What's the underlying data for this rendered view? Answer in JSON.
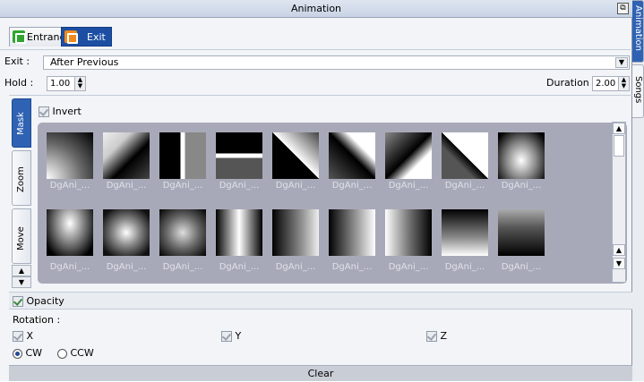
{
  "window": {
    "title": "Animation"
  },
  "tabs": {
    "entrance": "Entrance",
    "exit": "Exit"
  },
  "exit_row": {
    "label": "Exit :",
    "value": "After Previous"
  },
  "hold": {
    "label": "Hold :",
    "value": "1.00"
  },
  "duration": {
    "label": "Duration :",
    "value": "2.00"
  },
  "side_tabs": [
    "Mask",
    "Zoom",
    "Move"
  ],
  "invert": {
    "label": "Invert",
    "checked": true
  },
  "gallery": {
    "row1": [
      "DgAni_...",
      "DgAni_...",
      "DgAni_...",
      "DgAni_...",
      "DgAni_...",
      "DgAni_...",
      "DgAni_...",
      "DgAni_...",
      "DgAni_..."
    ],
    "row2": [
      "DgAni_...",
      "DgAni_...",
      "DgAni_...",
      "DgAni_...",
      "DgAni_...",
      "DgAni_...",
      "DgAni_...",
      "DgAni_...",
      "DgAni_..."
    ]
  },
  "opacity": {
    "label": "Opacity",
    "checked": true
  },
  "rotation": {
    "label": "Rotation :",
    "x": "X",
    "y": "Y",
    "z": "Z",
    "cw": "CW",
    "ccw": "CCW",
    "selected": "CW"
  },
  "clear": {
    "label": "Clear"
  },
  "right_tabs": [
    "Animation",
    "Songs"
  ],
  "colors": {
    "accent": "#2f62b3",
    "gallery_bg": "#a8a9b8"
  }
}
